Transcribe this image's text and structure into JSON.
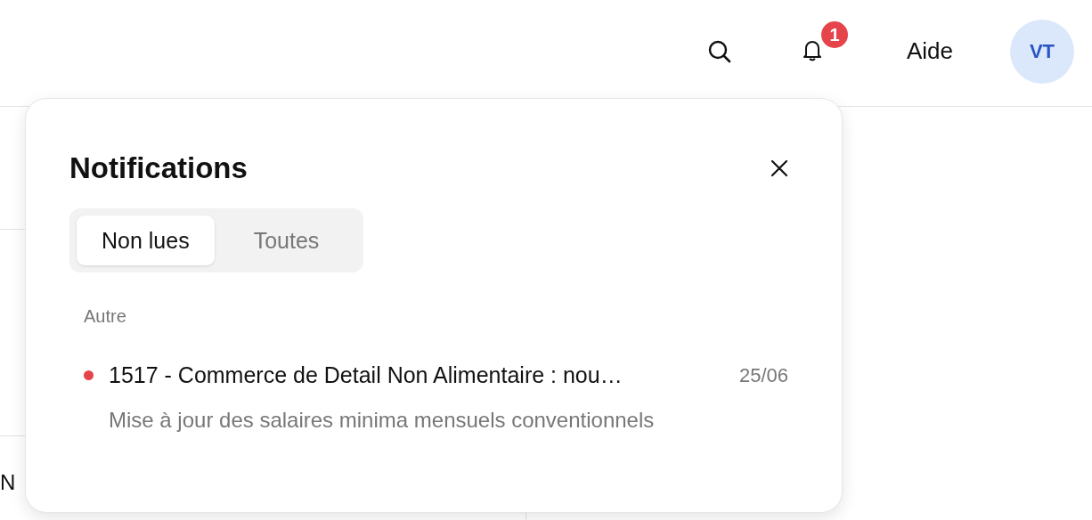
{
  "header": {
    "notification_count": "1",
    "help_link": "Aide",
    "avatar_initials": "VT"
  },
  "background": {
    "partial_text": "N"
  },
  "notifications_panel": {
    "title": "Notifications",
    "tabs": [
      {
        "label": "Non lues",
        "selected": true
      },
      {
        "label": "Toutes",
        "selected": false
      }
    ],
    "groups": [
      {
        "heading": "Autre",
        "items": [
          {
            "title": "1517 - Commerce de Detail Non Alimentaire : nou…",
            "date": "25/06",
            "description": "Mise à jour des salaires minima mensuels conventionnels",
            "unread": true
          }
        ]
      }
    ]
  }
}
